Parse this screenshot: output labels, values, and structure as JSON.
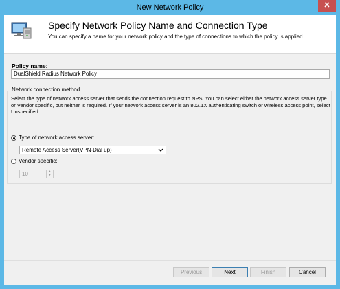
{
  "window": {
    "title": "New Network Policy",
    "close_glyph": "✕"
  },
  "header": {
    "title": "Specify Network Policy Name and Connection Type",
    "subtitle": "You can specify a name for your network policy and the type of connections to which the policy is applied.",
    "icon": "network-computer-icon"
  },
  "policy": {
    "label": "Policy name:",
    "value": "DualShield Radius Network Policy"
  },
  "connection": {
    "group_label": "Network connection method",
    "description": "Select the type of network access server that sends the connection request to NPS. You can select either the network access server type or Vendor specific, but neither is required.  If your network access server is an 802.1X authenticating switch or wireless access point, select Unspecified.",
    "type_radio_label": "Type of network access server:",
    "type_selected": true,
    "type_value": "Remote Access Server(VPN-Dial up)",
    "vendor_radio_label": "Vendor specific:",
    "vendor_selected": false,
    "vendor_value": "10"
  },
  "buttons": {
    "previous": "Previous",
    "next": "Next",
    "finish": "Finish",
    "cancel": "Cancel"
  }
}
